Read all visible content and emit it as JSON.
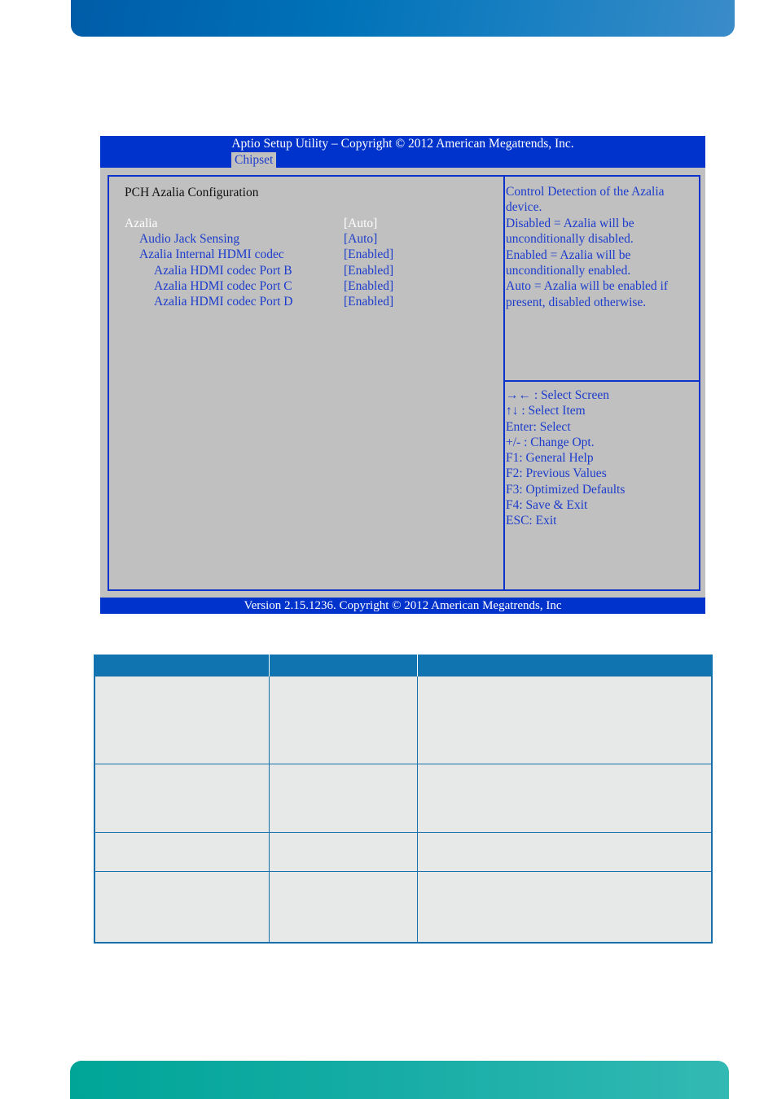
{
  "bios": {
    "title": "Aptio Setup Utility  –  Copyright © 2012 American Megatrends, Inc.",
    "active_tab": "Chipset",
    "footer": "Version 2.15.1236. Copyright © 2012 American Megatrends, Inc",
    "section_title": "PCH Azalia Configuration",
    "settings": [
      {
        "label": "Azalia",
        "value": "[Auto]",
        "selected": true
      },
      {
        "label": "Audio Jack Sensing",
        "value": "[Auto]",
        "selected": false
      },
      {
        "label": "Azalia Internal HDMI codec",
        "value": "[Enabled]",
        "selected": false
      },
      {
        "label": "Azalia HDMI codec Port B",
        "value": "[Enabled]",
        "selected": false
      },
      {
        "label": "Azalia HDMI codec Port C",
        "value": "[Enabled]",
        "selected": false
      },
      {
        "label": "Azalia HDMI codec Port D",
        "value": "[Enabled]",
        "selected": false
      }
    ],
    "help_lines": [
      "Control Detection of the Azalia",
      "device.",
      "Disabled = Azalia will be",
      "unconditionally disabled.",
      "Enabled = Azalia will be",
      "unconditionally enabled.",
      "Auto = Azalia will be enabled if",
      "present, disabled otherwise."
    ],
    "key_legend": [
      "→← : Select Screen",
      "↑↓ : Select Item",
      "Enter: Select",
      "+/- : Change Opt.",
      "F1: General Help",
      "F2: Previous Values",
      "F3: Optimized Defaults",
      "F4: Save & Exit",
      "ESC: Exit"
    ]
  },
  "table": {
    "headers": [
      "",
      "",
      ""
    ],
    "rows": [
      [
        "",
        "",
        ""
      ],
      [
        "",
        "",
        ""
      ],
      [
        "",
        "",
        ""
      ],
      [
        "",
        "",
        ""
      ]
    ]
  },
  "colors": {
    "bios_blue": "#0033cc",
    "bios_gray": "#c0c0c0",
    "bios_text_blue": "#1c3ccc",
    "table_header": "#0f74b0",
    "table_cell": "#e7e8e8"
  }
}
